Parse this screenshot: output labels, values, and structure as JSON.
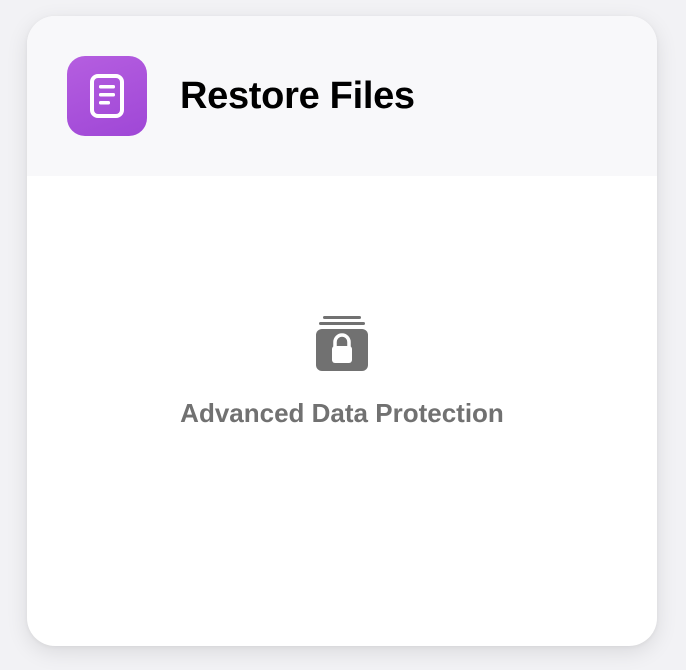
{
  "header": {
    "icon": "document-icon",
    "icon_color": "#a24fd8",
    "title": "Restore Files"
  },
  "body": {
    "icon": "locked-stack-icon",
    "icon_color": "#717171",
    "label": "Advanced Data Protection"
  }
}
